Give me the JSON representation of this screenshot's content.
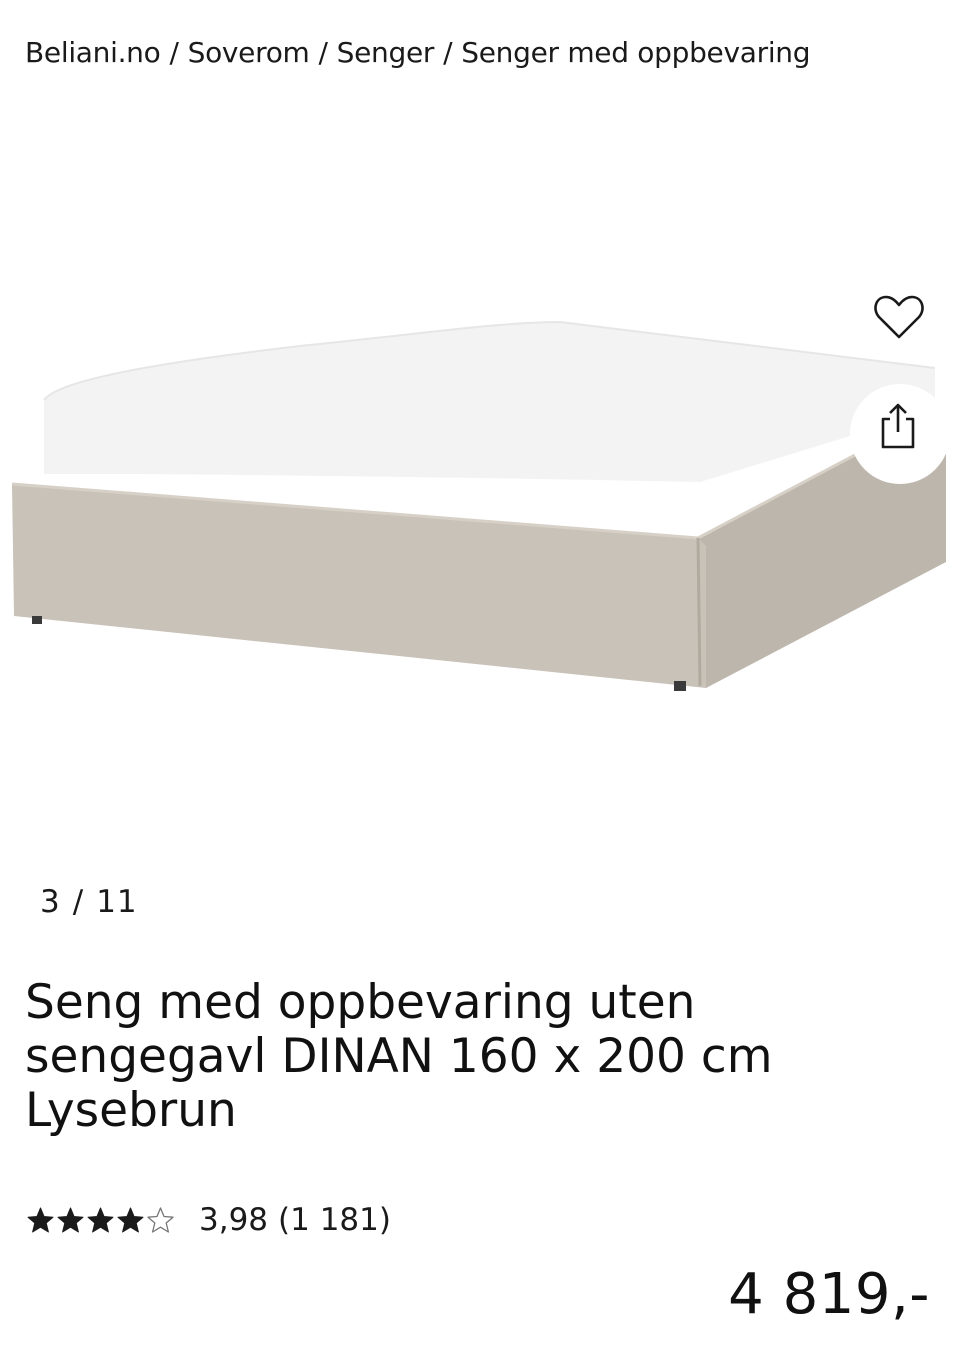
{
  "breadcrumb": [
    {
      "label": "Beliani.no"
    },
    {
      "label": "Soverom"
    },
    {
      "label": "Senger"
    },
    {
      "label": "Senger med oppbevaring"
    }
  ],
  "breadcrumb_separator": "/",
  "gallery": {
    "current": "3",
    "separator": "/",
    "total": "11",
    "product_color": "#c7c0b6",
    "favorite_icon": "heart-outline-icon",
    "share_icon": "share-icon"
  },
  "product": {
    "title": "Seng med oppbevaring uten sengegavl DINAN 160 x 200 cm Lysebrun",
    "rating": {
      "value_text": "3,98",
      "count_text": "(1 181)",
      "stars_filled": 4,
      "stars_total": 5
    },
    "price": "4 819,-"
  }
}
